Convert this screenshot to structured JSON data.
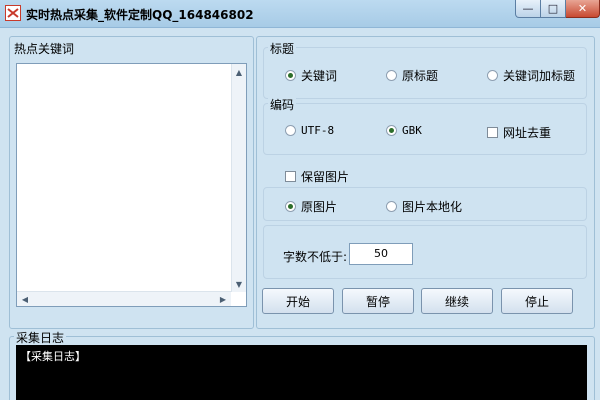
{
  "window": {
    "title": "实时热点采集_软件定制QQ_164846802",
    "min_glyph": "—",
    "max_glyph": "□",
    "close_glyph": "✕"
  },
  "keywords": {
    "label": "热点关键词",
    "up_arrow": "▲",
    "down_arrow": "▼",
    "left_arrow": "◀",
    "right_arrow": "▶"
  },
  "title_group": {
    "label": "标题",
    "options": [
      {
        "label": "关键词",
        "checked": true
      },
      {
        "label": "原标题",
        "checked": false
      },
      {
        "label": "关键词加标题",
        "checked": false
      }
    ]
  },
  "encoding_group": {
    "label": "编码",
    "options": [
      {
        "label": "UTF-8",
        "checked": false
      },
      {
        "label": "GBK",
        "checked": true
      }
    ],
    "dedupe_label": "网址去重",
    "dedupe_checked": false
  },
  "images": {
    "keep_label": "保留图片",
    "keep_checked": false,
    "options": [
      {
        "label": "原图片",
        "checked": true
      },
      {
        "label": "图片本地化",
        "checked": false
      }
    ]
  },
  "word_count": {
    "label": "字数不低于:",
    "value": "50"
  },
  "buttons": {
    "start": "开始",
    "pause": "暂停",
    "resume": "继续",
    "stop": "停止"
  },
  "log": {
    "label": "采集日志",
    "lines": [
      "【采集日志】"
    ]
  },
  "colors": {
    "window_bg": "#cfe3f1",
    "titlebar": "#a7cbe6",
    "close_button": "#c84a32",
    "radio_dot": "#2d6e2a",
    "log_bg": "#000000"
  }
}
